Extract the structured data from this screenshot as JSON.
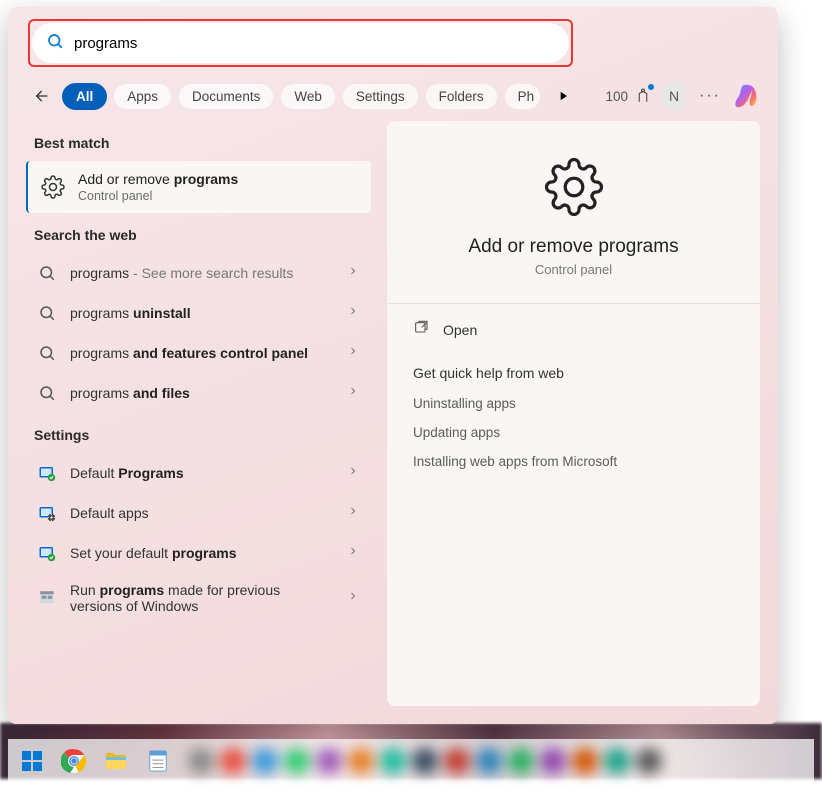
{
  "search": {
    "value": "programs",
    "placeholder": ""
  },
  "tabs": {
    "active": "All",
    "items": [
      "All",
      "Apps",
      "Documents",
      "Web",
      "Settings",
      "Folders",
      "Ph"
    ]
  },
  "points": {
    "value": "100"
  },
  "avatar": {
    "initial": "N"
  },
  "bestMatch": {
    "sectionLabel": "Best match",
    "prefix": "Add or remove ",
    "bold": "programs",
    "subtitle": "Control panel"
  },
  "webSection": {
    "label": "Search the web",
    "items": [
      {
        "text": "programs",
        "suffix": " - See more search results",
        "bold": ""
      },
      {
        "text": "programs ",
        "bold": "uninstall",
        "suffix": ""
      },
      {
        "text": "programs ",
        "bold": "and features control panel",
        "suffix": ""
      },
      {
        "text": "programs ",
        "bold": "and files",
        "suffix": ""
      }
    ]
  },
  "settingsSection": {
    "label": "Settings",
    "items": [
      {
        "icon": "default-programs",
        "pre": "Default ",
        "bold": "Programs",
        "post": ""
      },
      {
        "icon": "default-apps",
        "pre": "Default apps",
        "bold": "",
        "post": ""
      },
      {
        "icon": "set-default",
        "pre": "Set your default ",
        "bold": "programs",
        "post": ""
      },
      {
        "icon": "compat",
        "pre": "Run ",
        "bold": "programs",
        "post": " made for previous versions of Windows"
      }
    ]
  },
  "detail": {
    "title": "Add or remove programs",
    "subtitle": "Control panel",
    "openLabel": "Open",
    "helpLabel": "Get quick help from web",
    "helpLinks": [
      "Uninstalling apps",
      "Updating apps",
      "Installing web apps from Microsoft"
    ]
  }
}
